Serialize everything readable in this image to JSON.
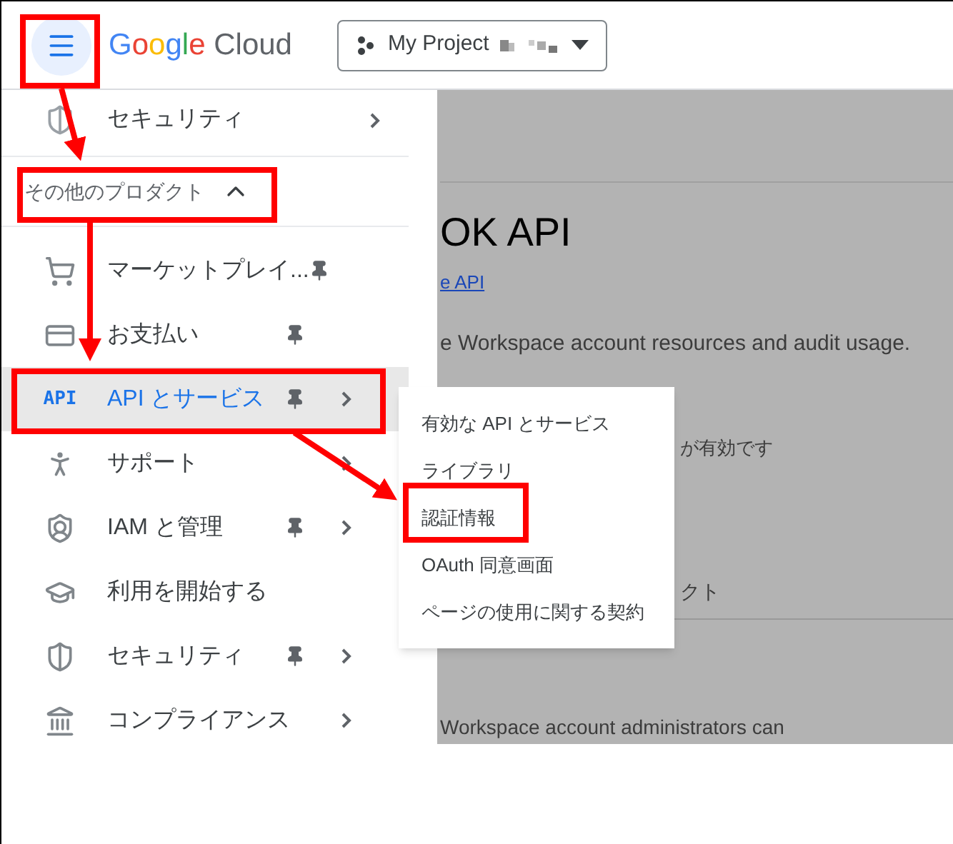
{
  "header": {
    "logo": [
      "Google",
      "Cloud"
    ],
    "project": "My Project"
  },
  "sidebar": {
    "top_item": {
      "label": "セキュリティ",
      "submenu": true
    },
    "section": {
      "label": "その他のプロダクト",
      "expanded": true
    },
    "items": [
      {
        "label": "マーケットプレイ...",
        "pinned": true,
        "submenu": false,
        "selected": false
      },
      {
        "label": "お支払い",
        "pinned": true,
        "submenu": false,
        "selected": false
      },
      {
        "icon_text": "API",
        "label": "API とサービス",
        "pinned": true,
        "submenu": true,
        "selected": true
      },
      {
        "label": "サポート",
        "pinned": false,
        "submenu": true,
        "selected": false
      },
      {
        "label": "IAM と管理",
        "pinned": true,
        "submenu": true,
        "selected": false
      },
      {
        "label": "利用を開始する",
        "pinned": false,
        "submenu": false,
        "selected": false
      },
      {
        "label": "セキュリティ",
        "pinned": true,
        "submenu": true,
        "selected": false
      },
      {
        "label": "コンプライアンス",
        "pinned": false,
        "submenu": true,
        "selected": false
      }
    ]
  },
  "submenu": [
    "有効な API とサービス",
    "ライブラリ",
    "認証情報",
    "OAuth 同意画面",
    "ページの使用に関する契約"
  ],
  "background_page": {
    "title": "OK API",
    "link": "e API",
    "description": "e Workspace account resources and audit usage.",
    "status": "が有効です",
    "text_2": "クト",
    "text_3": "Workspace account administrators can"
  }
}
